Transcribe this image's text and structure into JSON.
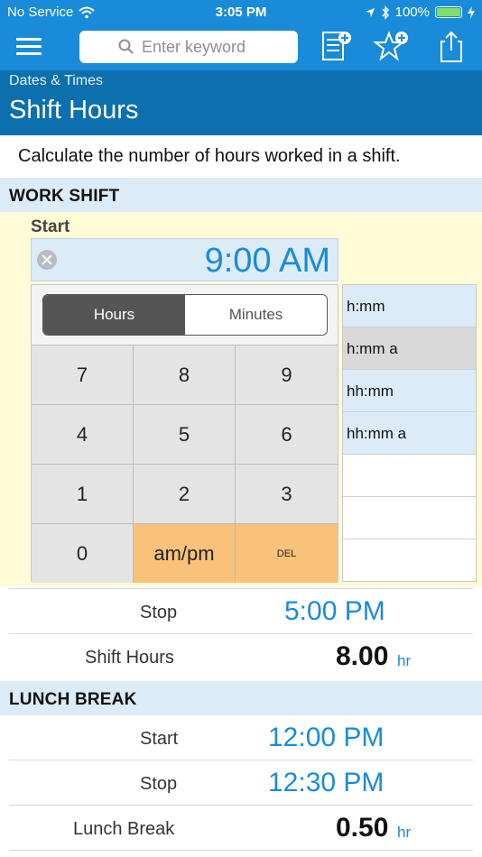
{
  "status_bar": {
    "carrier": "No Service",
    "time": "3:05 PM",
    "battery": "100%"
  },
  "nav": {
    "search_placeholder": "Enter keyword"
  },
  "header": {
    "breadcrumb": "Dates & Times",
    "title": "Shift Hours"
  },
  "description": "Calculate the number of hours worked in a shift.",
  "work_shift": {
    "heading": "WORK SHIFT",
    "start_label": "Start",
    "start_value": "9:00 AM",
    "segments": {
      "hours": "Hours",
      "minutes": "Minutes"
    },
    "keys": [
      "7",
      "8",
      "9",
      "4",
      "5",
      "6",
      "1",
      "2",
      "3",
      "0",
      "am/pm",
      "DEL"
    ],
    "formats": [
      "h:mm",
      "h:mm a",
      "hh:mm",
      "hh:mm a"
    ],
    "stop_label": "Stop",
    "stop_value": "5:00 PM",
    "hours_label": "Shift Hours",
    "hours_value": "8.00",
    "hours_unit": "hr"
  },
  "lunch_break": {
    "heading": "LUNCH BREAK",
    "start_label": "Start",
    "start_value": "12:00 PM",
    "stop_label": "Stop",
    "stop_value": "12:30 PM",
    "break_label": "Lunch Break",
    "break_value": "0.50",
    "break_unit": "hr"
  },
  "colors": {
    "accent": "#1a8bd8",
    "header": "#0c6fae",
    "section": "#dcebf8",
    "keypad_orange": "#f8c27a",
    "highlight": "#fffbd6"
  }
}
